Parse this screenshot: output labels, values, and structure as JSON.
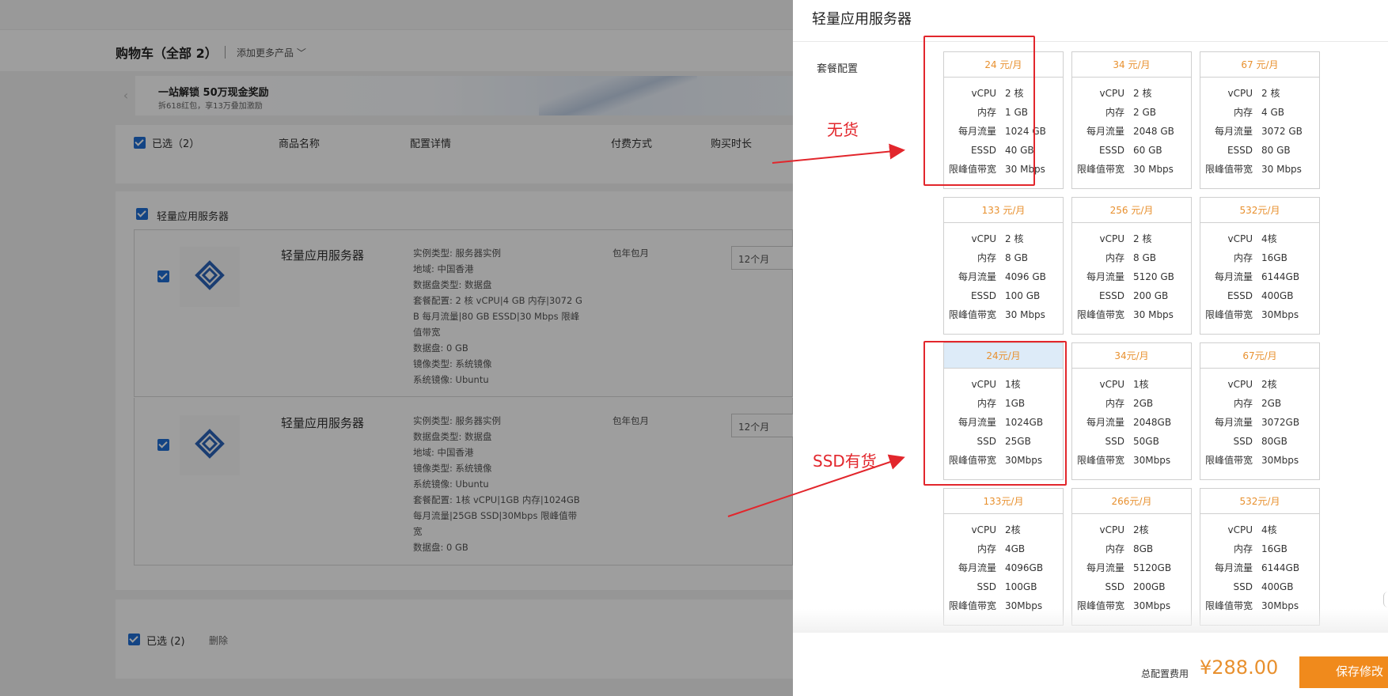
{
  "cart": {
    "title": "购物车（全部 2）",
    "add_more": "添加更多产品",
    "banner_title": "一站解锁 50万现金奖励",
    "banner_sub": "拆618红包，享13万叠加激励",
    "headers": {
      "selected": "已选（2）",
      "name": "商品名称",
      "config": "配置详情",
      "pay": "付费方式",
      "duration": "购买时长"
    },
    "group_title": "轻量应用服务器",
    "items": [
      {
        "name": "轻量应用服务器",
        "specs": [
          "实例类型: 服务器实例",
          "地域: 中国香港",
          "数据盘类型: 数据盘",
          "套餐配置: 2 核 vCPU|4 GB 内存|3072 G",
          "B 每月流量|80 GB ESSD|30 Mbps 限峰",
          "值带宽",
          "数据盘: 0 GB",
          "镜像类型: 系统镜像",
          "系统镜像: Ubuntu"
        ],
        "pay": "包年包月",
        "duration": "12个月"
      },
      {
        "name": "轻量应用服务器",
        "specs": [
          "实例类型: 服务器实例",
          "数据盘类型: 数据盘",
          "地域: 中国香港",
          "镜像类型: 系统镜像",
          "系统镜像: Ubuntu",
          "套餐配置: 1核 vCPU|1GB 内存|1024GB",
          "每月流量|25GB SSD|30Mbps 限峰值带",
          "宽",
          "数据盘: 0 GB"
        ],
        "pay": "包年包月",
        "duration": "12个月"
      }
    ],
    "footer_selected": "已选 (2)",
    "footer_delete": "删除"
  },
  "drawer": {
    "title": "轻量应用服务器",
    "plan_label": "套餐配置",
    "annot_out": "无货",
    "annot_ssd": "SSD有货",
    "total_label": "总配置费用",
    "total_price": "¥288.00",
    "save_button": "保存修改",
    "spec_keys": {
      "vcpu": "vCPU",
      "mem": "内存",
      "traffic": "每月流量",
      "bw": "限峰值带宽"
    },
    "plans": [
      {
        "price": "24 元/月",
        "vcpu": "2 核",
        "mem": "1 GB",
        "traffic": "1024 GB",
        "disk_label": "ESSD",
        "disk": "40 GB",
        "bw": "30 Mbps"
      },
      {
        "price": "34 元/月",
        "vcpu": "2 核",
        "mem": "2 GB",
        "traffic": "2048 GB",
        "disk_label": "ESSD",
        "disk": "60 GB",
        "bw": "30 Mbps"
      },
      {
        "price": "67 元/月",
        "vcpu": "2 核",
        "mem": "4 GB",
        "traffic": "3072 GB",
        "disk_label": "ESSD",
        "disk": "80 GB",
        "bw": "30 Mbps"
      },
      {
        "price": "133 元/月",
        "vcpu": "2 核",
        "mem": "8 GB",
        "traffic": "4096 GB",
        "disk_label": "ESSD",
        "disk": "100 GB",
        "bw": "30 Mbps"
      },
      {
        "price": "256 元/月",
        "vcpu": "2 核",
        "mem": "8 GB",
        "traffic": "5120 GB",
        "disk_label": "ESSD",
        "disk": "200 GB",
        "bw": "30 Mbps"
      },
      {
        "price": "532元/月",
        "vcpu": "4核",
        "mem": "16GB",
        "traffic": "6144GB",
        "disk_label": "ESSD",
        "disk": "400GB",
        "bw": "30Mbps"
      },
      {
        "price": "24元/月",
        "vcpu": "1核",
        "mem": "1GB",
        "traffic": "1024GB",
        "disk_label": "SSD",
        "disk": "25GB",
        "bw": "30Mbps",
        "selected": true
      },
      {
        "price": "34元/月",
        "vcpu": "1核",
        "mem": "2GB",
        "traffic": "2048GB",
        "disk_label": "SSD",
        "disk": "50GB",
        "bw": "30Mbps"
      },
      {
        "price": "67元/月",
        "vcpu": "2核",
        "mem": "2GB",
        "traffic": "3072GB",
        "disk_label": "SSD",
        "disk": "80GB",
        "bw": "30Mbps"
      },
      {
        "price": "133元/月",
        "vcpu": "2核",
        "mem": "4GB",
        "traffic": "4096GB",
        "disk_label": "SSD",
        "disk": "100GB",
        "bw": "30Mbps"
      },
      {
        "price": "266元/月",
        "vcpu": "2核",
        "mem": "8GB",
        "traffic": "5120GB",
        "disk_label": "SSD",
        "disk": "200GB",
        "bw": "30Mbps"
      },
      {
        "price": "532元/月",
        "vcpu": "4核",
        "mem": "16GB",
        "traffic": "6144GB",
        "disk_label": "SSD",
        "disk": "400GB",
        "bw": "30Mbps"
      }
    ]
  },
  "colors": {
    "accent_orange": "#f08a1c",
    "price_orange": "#e8902e",
    "highlight_red": "#e2262c",
    "checkbox_blue": "#1f6fd6",
    "selected_blue": "#ddebf8"
  }
}
